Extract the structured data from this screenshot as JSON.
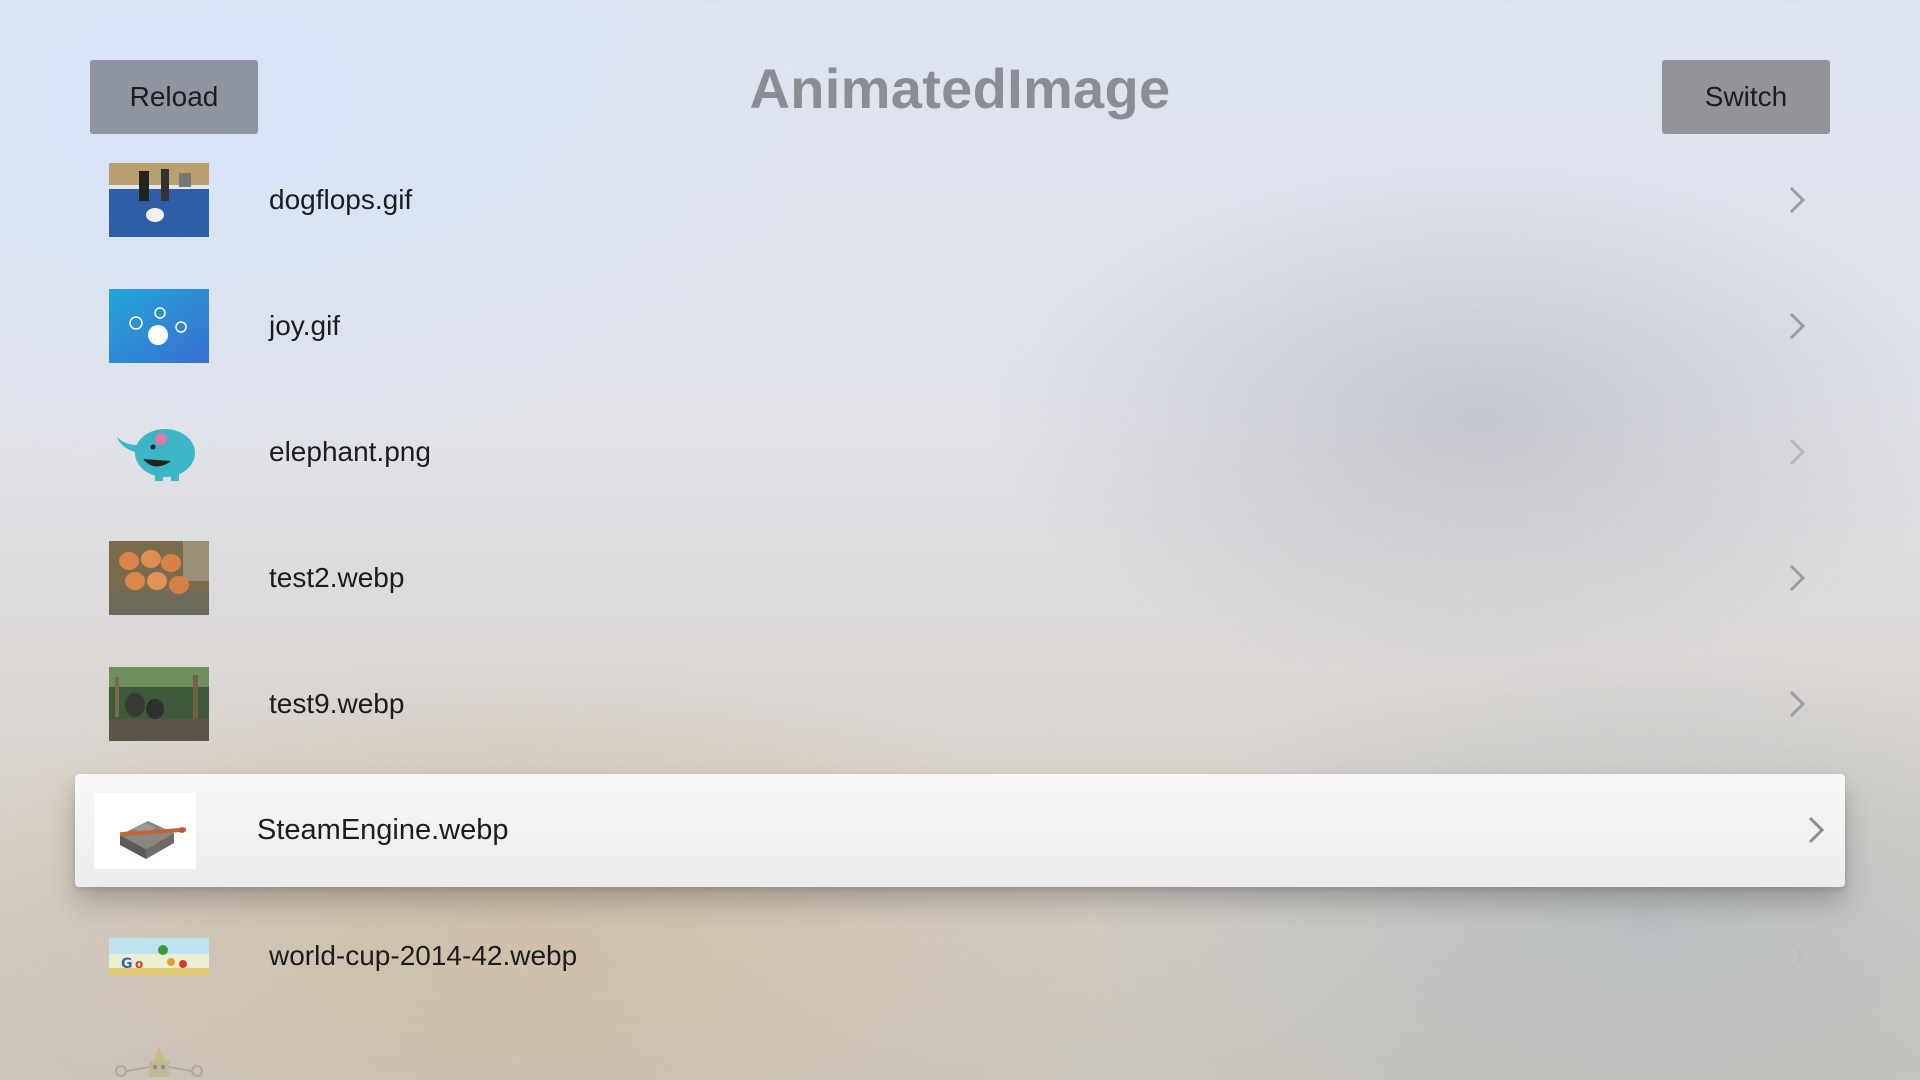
{
  "header": {
    "title": "AnimatedImage",
    "reload_label": "Reload",
    "switch_label": "Switch"
  },
  "list": {
    "items": [
      {
        "label": "dogflops.gif",
        "thumb": "dog-gif-thumbnail"
      },
      {
        "label": "joy.gif",
        "thumb": "joy-gif-thumbnail"
      },
      {
        "label": "elephant.png",
        "thumb": "elephant-png-thumbnail"
      },
      {
        "label": "test2.webp",
        "thumb": "eggs-thumbnail"
      },
      {
        "label": "test9.webp",
        "thumb": "elephants-photo-thumbnail"
      },
      {
        "label": "SteamEngine.webp",
        "thumb": "steam-engine-thumbnail",
        "focused": true
      },
      {
        "label": "world-cup-2014-42.webp",
        "thumb": "google-doodle-thumbnail"
      },
      {
        "label": "",
        "thumb": "pixel-art-thumbnail"
      }
    ]
  },
  "colors": {
    "button_bg": "#8f959e",
    "title": "#8a8d93",
    "text": "#1c1c1e",
    "focused_row_bg": "#f2f2f2"
  },
  "icons": {
    "row_chevron": "chevron-right-icon"
  }
}
